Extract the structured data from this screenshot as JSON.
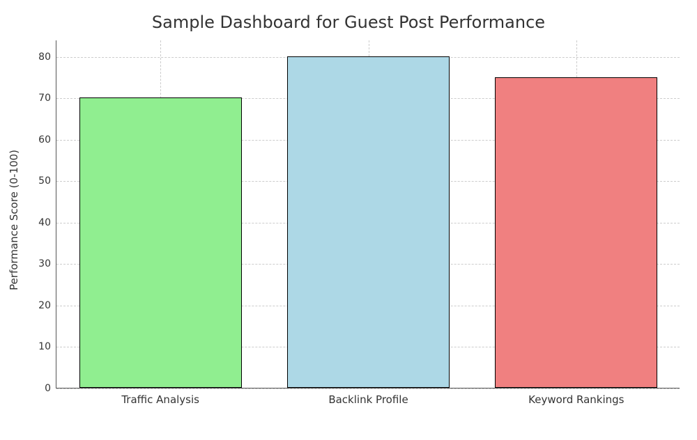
{
  "chart_data": {
    "type": "bar",
    "title": "Sample Dashboard for Guest Post Performance",
    "xlabel": "",
    "ylabel": "Performance Score (0-100)",
    "categories": [
      "Traffic Analysis",
      "Backlink Profile",
      "Keyword Rankings"
    ],
    "values": [
      70,
      80,
      75
    ],
    "colors": [
      "#90ee90",
      "#add8e6",
      "#f08080"
    ],
    "ylim": [
      0,
      84
    ],
    "yticks": [
      0,
      10,
      20,
      30,
      40,
      50,
      60,
      70,
      80
    ]
  }
}
